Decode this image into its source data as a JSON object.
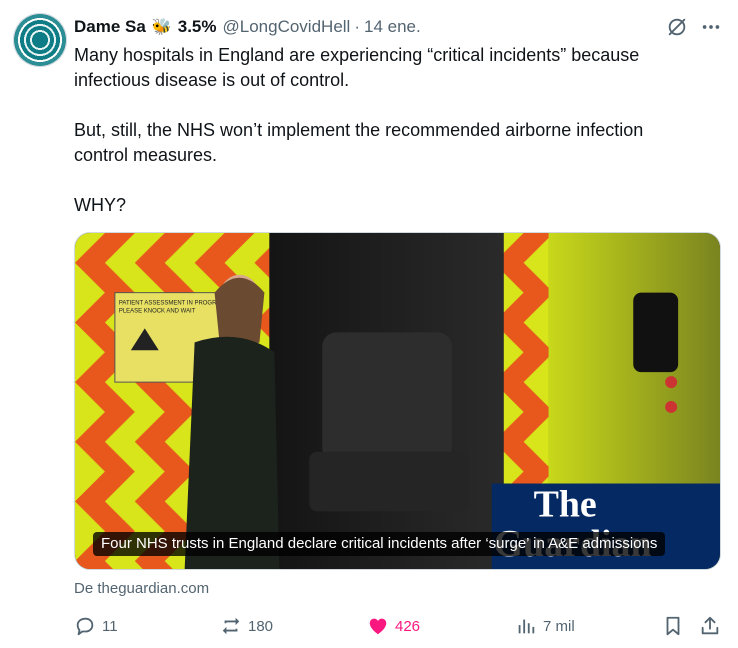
{
  "tweet": {
    "display_name": "Dame Sa",
    "emoji": "🐝",
    "badge_text": "3.5%",
    "handle": "@LongCovidHell",
    "separator": "·",
    "date": "14 ene.",
    "paragraphs": [
      "Many hospitals in England are experiencing “critical incidents” because infectious disease is out of control.",
      "But, still, the NHS won’t implement the recommended airborne infection control measures.",
      "WHY?"
    ]
  },
  "card": {
    "caption": "Four NHS trusts in England declare critical incidents after ‘surge’ in A&E admissions",
    "source": "De theguardian.com",
    "image_text": {
      "sign_top": "PATIENT ASSESSMENT IN PROGRESS",
      "sign_top2": "PLEASE KNOCK AND WAIT",
      "logo_line1": "The",
      "logo_line2": "Guardian"
    }
  },
  "actions": {
    "replies": "11",
    "reposts": "180",
    "likes": "426",
    "views": "7 mil"
  },
  "colors": {
    "like": "#f91880",
    "muted": "#536471",
    "guardian_blue": "#052962"
  },
  "icons": [
    "avatar",
    "grok-icon",
    "more-icon",
    "reply-icon",
    "repost-icon",
    "heart-icon",
    "views-icon",
    "bookmark-icon",
    "share-icon"
  ]
}
